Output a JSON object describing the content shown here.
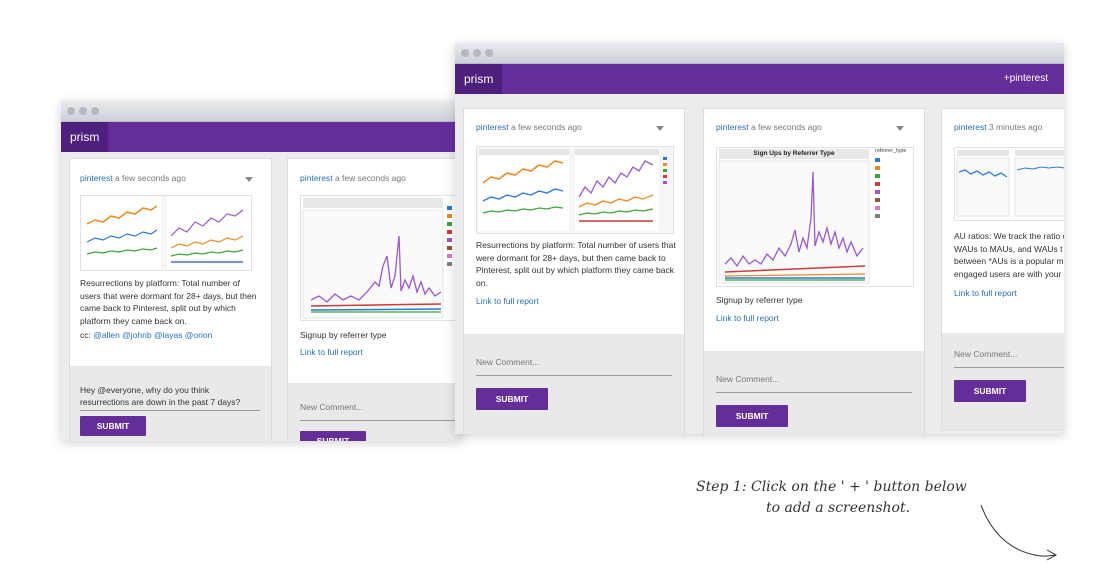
{
  "app": {
    "logo": "prism",
    "nav_right": "+pinterest"
  },
  "left_window": {
    "card1": {
      "user": "pinterest",
      "time": " a few seconds ago",
      "description": "Resurrections by platform: Total number of users that were dormant for 28+ days, but then came back to Pinterest, split out by which platform they came back on.",
      "cc_prefix": "cc: ",
      "cc_mentions": "@allen @johnb @layas @orion",
      "comment": "Hey @everyone, why do you think resurrections are down in the past 7 days?",
      "submit": "SUBMIT"
    },
    "card2": {
      "user": "pinterest",
      "time": " a few seconds ago",
      "description": "Signup by referrer type",
      "link": "Link to full report",
      "comment_placeholder": "New Comment...",
      "submit": "SUBMIT"
    }
  },
  "right_window": {
    "card1": {
      "user": "pinterest",
      "time": " a few seconds ago",
      "description": "Resurrections by platform: Total number of users that were dormant for 28+ days, but then came back to Pinterest, split out by which platform they came back on.",
      "link": "Link to full report",
      "comment_placeholder": "New Comment...",
      "submit": "SUBMIT"
    },
    "card2": {
      "user": "pinterest",
      "time": " a few seconds ago",
      "chart_title": "Sign Ups by Referrer Type",
      "legend_title": "referrer_type",
      "description": "Signup by referrer type",
      "link": "Link to full report",
      "comment_placeholder": "New Comment...",
      "submit": "SUBMIT"
    },
    "card3": {
      "user": "pinterest",
      "time": " 3 minutes ago",
      "description": "AU ratios: We track the ratio o WAUs to MAUs, and WAUs t between *AUs is a popular m engaged users are with your",
      "link": "Link to full report",
      "comment_placeholder": "New Comment...",
      "submit": "SUBMIT"
    }
  },
  "instruction": {
    "line1": "Step 1: Click on the ' + ' button below",
    "line2": "to add a screenshot."
  },
  "colors": {
    "brand": "#652d9a",
    "brand_dark": "#4f1f7e",
    "link": "#2a71b8"
  }
}
